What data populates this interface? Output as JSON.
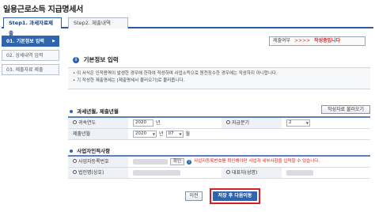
{
  "page_title": "일용근로소득 지급명세서",
  "tabs": [
    {
      "label": "Step1. 과세자료제출",
      "active": true
    },
    {
      "label": "Step2. 제출내역",
      "active": false
    }
  ],
  "steps": [
    {
      "label": "01. 기본정보 입력",
      "active": true
    },
    {
      "label": "02. 상세내역 입력",
      "active": false
    },
    {
      "label": "03. 제출자료 제출",
      "active": false
    }
  ],
  "status": {
    "label": "제출여부",
    "arrows": ">>>>",
    "value": "작성중입니다"
  },
  "section_title": "기본정보 입력",
  "notice": {
    "line1": "• 이 서식은 인적용역이 발생한 경우에 한하여 작성하며 사업소득으로 원천징수한 경우에는 작성하지 아니합니다.",
    "line2": "• 기 작성한 제출명세는 [제출명세서 불러오기]로 불러옵니다."
  },
  "tax_period": {
    "title": "과세년월, 제출년월",
    "load_button": "작성자료 불러오기",
    "attr_year_label": "귀속연도",
    "attr_year_value": "2020",
    "year_unit": "년",
    "pay_period_label": "지급분기",
    "pay_period_value": "2",
    "submit_date_label": "제출년월",
    "submit_year": "2020",
    "submit_month": "07",
    "month_unit": "월"
  },
  "business": {
    "title": "사업자인적사항",
    "biz_no_label": "사업자등록번호",
    "verify_button": "확인",
    "biz_no_note": "사업자등록번호를 확인해야만 사업자 세부사항을 입력할 수 있습니다.",
    "corp_name_label": "법인명(상호)",
    "rep_name_label": "대표자(성명)"
  },
  "buttons": {
    "prev": "이전",
    "next": "저장 후 다음이동"
  }
}
